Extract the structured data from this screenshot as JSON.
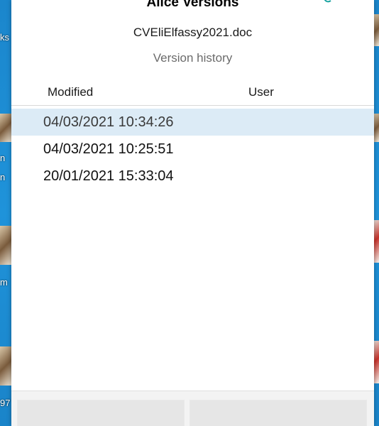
{
  "dialog": {
    "title": "Alice Versions",
    "filename": "CVEliElfassy2021.doc",
    "subtitle": "Version history"
  },
  "table": {
    "columns": [
      "Modified",
      "User"
    ],
    "rows": [
      {
        "modified": "04/03/2021 10:34:26",
        "user": "",
        "selected": true
      },
      {
        "modified": "04/03/2021 10:25:51",
        "user": "",
        "selected": false
      },
      {
        "modified": "20/01/2021 15:33:04",
        "user": "",
        "selected": false
      }
    ]
  },
  "footer": {
    "left_button_label": "",
    "right_button_label": ""
  },
  "background": {
    "left_labels": [
      "ks",
      "n",
      "n",
      "m",
      "97"
    ]
  },
  "colors": {
    "selected_row": "#dcebf6",
    "desktop": "#1e8fd6"
  },
  "icons": {
    "corner": "sync-icon"
  }
}
